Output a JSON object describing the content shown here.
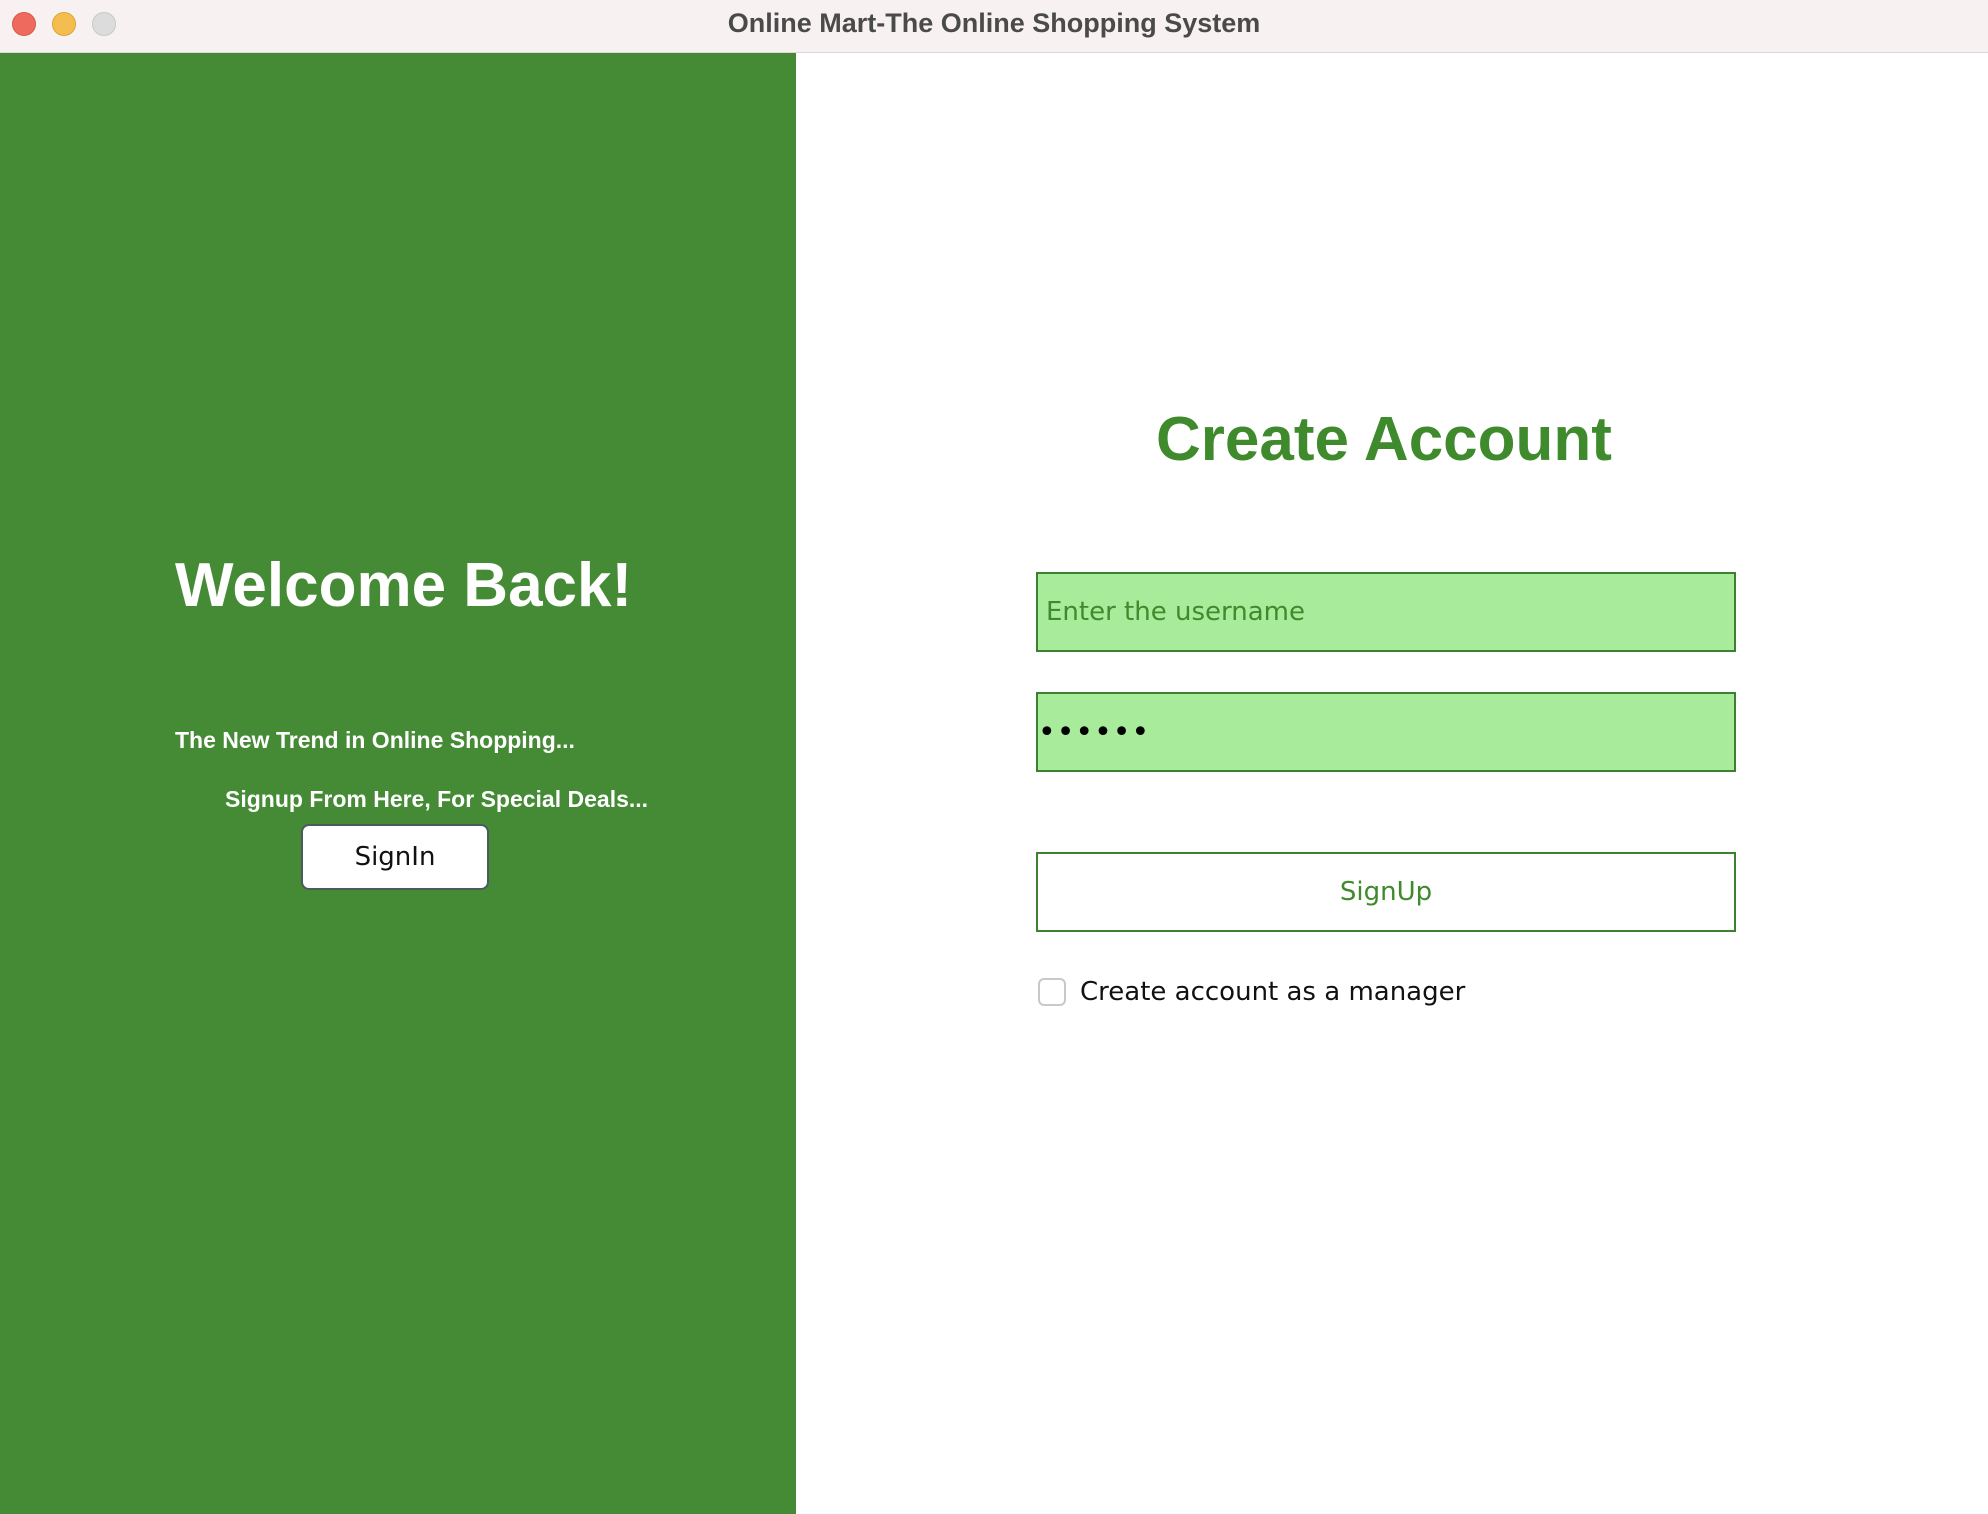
{
  "window": {
    "title": "Online Mart-The Online Shopping System"
  },
  "left_panel": {
    "heading": "Welcome Back!",
    "tagline": "The New Trend in Online Shopping...",
    "subline": "Signup From Here, For Special Deals...",
    "signin_label": "SignIn",
    "background_color": "#458a34"
  },
  "right_panel": {
    "heading": "Create Account",
    "username": {
      "value": "",
      "placeholder": "Enter the username"
    },
    "password": {
      "value": "••••••"
    },
    "signup_label": "SignUp",
    "manager_checkbox": {
      "label": "Create account as a manager",
      "checked": false
    },
    "accent_color": "#3f8a2c",
    "field_color": "#a7eb9b"
  }
}
